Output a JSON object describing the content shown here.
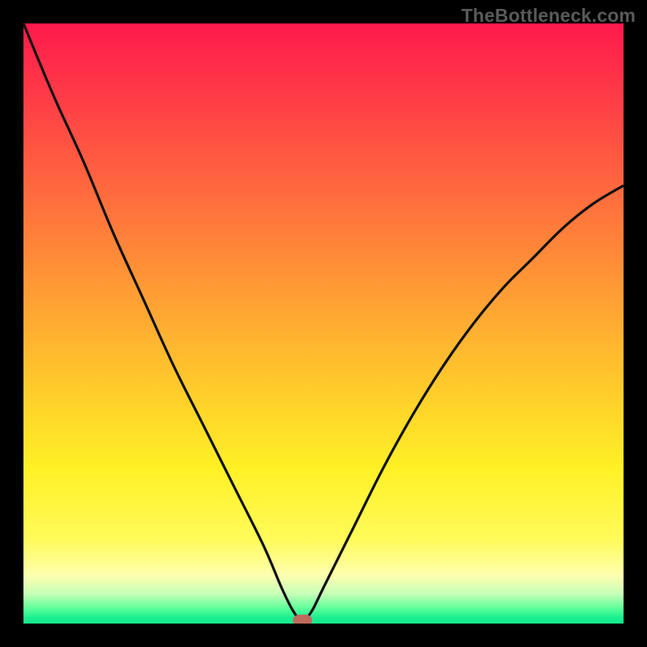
{
  "watermark": {
    "text": "TheBottleneck.com"
  },
  "colors": {
    "frame_bg": "#000000",
    "curve_stroke": "#111111",
    "marker_fill": "#c06a5d",
    "gradient_stops": [
      "#ff1a4c",
      "#ff3b47",
      "#ff6a3e",
      "#ff9a35",
      "#ffc92c",
      "#fff026",
      "#fffb59",
      "#fdffb0",
      "#c8ffb8",
      "#5dff9a",
      "#19f090",
      "#18e88c"
    ]
  },
  "chart_data": {
    "type": "line",
    "title": "",
    "xlabel": "",
    "ylabel": "",
    "xlim": [
      0,
      100
    ],
    "ylim": [
      0,
      100
    ],
    "grid": false,
    "legend": false,
    "note": "V-shaped bottleneck curve; y is mismatch percentage (high=red, low=green). Values read from vertical position against the color gradient.",
    "series": [
      {
        "name": "bottleneck-curve",
        "x": [
          0,
          5,
          10,
          15,
          20,
          25,
          30,
          35,
          40,
          43,
          45,
          46.5,
          48,
          50,
          55,
          60,
          65,
          70,
          75,
          80,
          85,
          90,
          95,
          100
        ],
        "y": [
          100,
          88,
          77,
          65,
          54,
          43,
          33,
          23,
          13,
          6,
          2,
          0.5,
          2,
          6,
          16,
          26,
          35,
          43,
          50,
          56,
          61,
          66,
          70,
          73
        ]
      }
    ],
    "marker": {
      "x": 46.5,
      "y": 0.5,
      "label": "optimal-point"
    }
  }
}
